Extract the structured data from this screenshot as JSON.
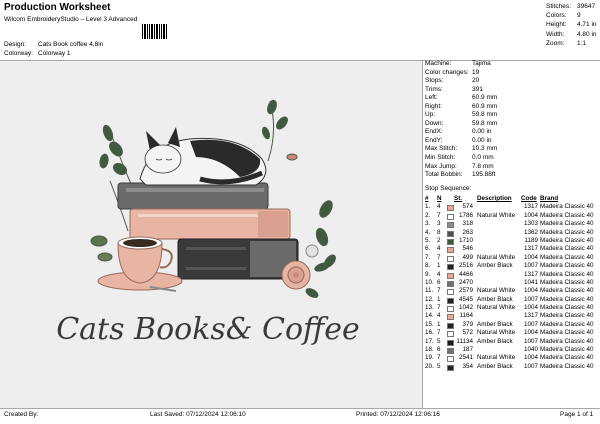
{
  "header": {
    "title": "Production Worksheet",
    "subtitle": "Wilcom EmbroideryStudio – Level 3 Advanced",
    "design_label": "Design:",
    "design_value": "Cats Book coffee 4,8in",
    "colorway_label": "Colorway:",
    "colorway_value": "Colorway 1"
  },
  "top_stats": [
    {
      "k": "Stitches:",
      "v": "39647"
    },
    {
      "k": "Colors:",
      "v": "9"
    },
    {
      "k": "Height:",
      "v": "4.71 in"
    },
    {
      "k": "Width:",
      "v": "4.80 in"
    },
    {
      "k": "Zoom:",
      "v": "1:1"
    }
  ],
  "design": {
    "lettering": "Cats Books& Coffee"
  },
  "machine": [
    {
      "k": "Machine:",
      "v": "Tajima"
    },
    {
      "k": "Color changes:",
      "v": "19"
    },
    {
      "k": "Stops:",
      "v": "20"
    },
    {
      "k": "Trims:",
      "v": "391"
    },
    {
      "k": "Left:",
      "v": "60.9 mm"
    },
    {
      "k": "Right:",
      "v": "60.9 mm"
    },
    {
      "k": "Up:",
      "v": "59.8 mm"
    },
    {
      "k": "Down:",
      "v": "59.8 mm"
    },
    {
      "k": "EndX:",
      "v": "0.00 in"
    },
    {
      "k": "EndY:",
      "v": "0.00 in"
    },
    {
      "k": "Max Stitch:",
      "v": "10.3 mm"
    },
    {
      "k": "Min Stitch:",
      "v": "0.0 mm"
    },
    {
      "k": "Max Jump:",
      "v": "7.8 mm"
    },
    {
      "k": "Total Bobbin:",
      "v": "195.88ft"
    }
  ],
  "stop_sequence": {
    "title": "Stop Sequence:",
    "headers": {
      "no": "#",
      "n": "N",
      "st": "St.",
      "desc": "Description",
      "code": "Code",
      "brand": "Brand"
    },
    "rows": [
      {
        "no": "1.",
        "n": "4",
        "color": "#e8a898",
        "st": "574",
        "desc": "",
        "code": "1317",
        "brand": "Madeira Classic 40"
      },
      {
        "no": "2.",
        "n": "7",
        "color": "#ffffff",
        "st": "1786",
        "desc": "Natural White",
        "code": "1004",
        "brand": "Madeira Classic 40"
      },
      {
        "no": "3.",
        "n": "3",
        "color": "#8c8c8c",
        "st": "318",
        "desc": "",
        "code": "1303",
        "brand": "Madeira Classic 40"
      },
      {
        "no": "4.",
        "n": "8",
        "color": "#505050",
        "st": "263",
        "desc": "",
        "code": "1362",
        "brand": "Madeira Classic 40"
      },
      {
        "no": "5.",
        "n": "2",
        "color": "#3a5a3a",
        "st": "1710",
        "desc": "",
        "code": "1189",
        "brand": "Madeira Classic 40"
      },
      {
        "no": "6.",
        "n": "4",
        "color": "#e8a898",
        "st": "546",
        "desc": "",
        "code": "1317",
        "brand": "Madeira Classic 40"
      },
      {
        "no": "7.",
        "n": "7",
        "color": "#ffffff",
        "st": "499",
        "desc": "Natural White",
        "code": "1004",
        "brand": "Madeira Classic 40"
      },
      {
        "no": "8.",
        "n": "1",
        "color": "#222222",
        "st": "2516",
        "desc": "Amber Black",
        "code": "1007",
        "brand": "Madeira Classic 40"
      },
      {
        "no": "9.",
        "n": "4",
        "color": "#e8a898",
        "st": "4466",
        "desc": "",
        "code": "1317",
        "brand": "Madeira Classic 40"
      },
      {
        "no": "10.",
        "n": "6",
        "color": "#707070",
        "st": "2470",
        "desc": "",
        "code": "1041",
        "brand": "Madeira Classic 40"
      },
      {
        "no": "11.",
        "n": "7",
        "color": "#ffffff",
        "st": "2579",
        "desc": "Natural White",
        "code": "1004",
        "brand": "Madeira Classic 40"
      },
      {
        "no": "12.",
        "n": "1",
        "color": "#222222",
        "st": "4545",
        "desc": "Amber Black",
        "code": "1007",
        "brand": "Madeira Classic 40"
      },
      {
        "no": "13.",
        "n": "7",
        "color": "#ffffff",
        "st": "1042",
        "desc": "Natural White",
        "code": "1004",
        "brand": "Madeira Classic 40"
      },
      {
        "no": "14.",
        "n": "4",
        "color": "#e8a898",
        "st": "1164",
        "desc": "",
        "code": "1317",
        "brand": "Madeira Classic 40"
      },
      {
        "no": "15.",
        "n": "1",
        "color": "#222222",
        "st": "379",
        "desc": "Amber Black",
        "code": "1007",
        "brand": "Madeira Classic 40"
      },
      {
        "no": "16.",
        "n": "7",
        "color": "#ffffff",
        "st": "572",
        "desc": "Natural White",
        "code": "1004",
        "brand": "Madeira Classic 40"
      },
      {
        "no": "17.",
        "n": "5",
        "color": "#1a1a1a",
        "st": "11134",
        "desc": "Amber Black",
        "code": "1007",
        "brand": "Madeira Classic 40"
      },
      {
        "no": "18.",
        "n": "6",
        "color": "#707070",
        "st": "187",
        "desc": "",
        "code": "1040",
        "brand": "Madeira Classic 40"
      },
      {
        "no": "19.",
        "n": "7",
        "color": "#ffffff",
        "st": "2541",
        "desc": "Natural White",
        "code": "1004",
        "brand": "Madeira Classic 40"
      },
      {
        "no": "20.",
        "n": "5",
        "color": "#222222",
        "st": "354",
        "desc": "Amber Black",
        "code": "1007",
        "brand": "Madeira Classic 40"
      }
    ]
  },
  "footer": {
    "created": "Created By:",
    "saved": "Last Saved: 07/12/2024 12:06:10",
    "printed": "Printed: 07/12/2024 12:06:16",
    "page": "Page 1 of 1"
  }
}
